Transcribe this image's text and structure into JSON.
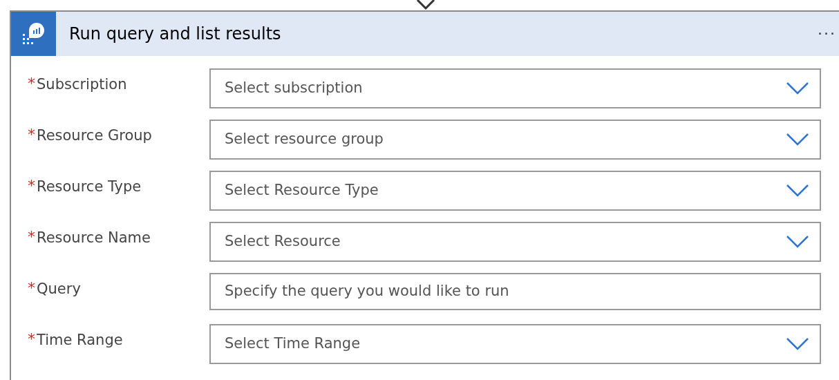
{
  "card": {
    "title": "Run query and list results",
    "menu": "···"
  },
  "fields": [
    {
      "label": "Subscription",
      "required_mark": "*",
      "kind": "dropdown",
      "placeholder": "Select subscription"
    },
    {
      "label": "Resource Group",
      "required_mark": "*",
      "kind": "dropdown",
      "placeholder": "Select resource group"
    },
    {
      "label": "Resource Type",
      "required_mark": "*",
      "kind": "dropdown",
      "placeholder": "Select Resource Type"
    },
    {
      "label": "Resource Name",
      "required_mark": "*",
      "kind": "dropdown",
      "placeholder": "Select Resource"
    },
    {
      "label": "Query",
      "required_mark": "*",
      "kind": "text",
      "placeholder": "Specify the query you would like to run"
    },
    {
      "label": "Time Range",
      "required_mark": "*",
      "kind": "dropdown",
      "placeholder": "Select Time Range"
    }
  ]
}
